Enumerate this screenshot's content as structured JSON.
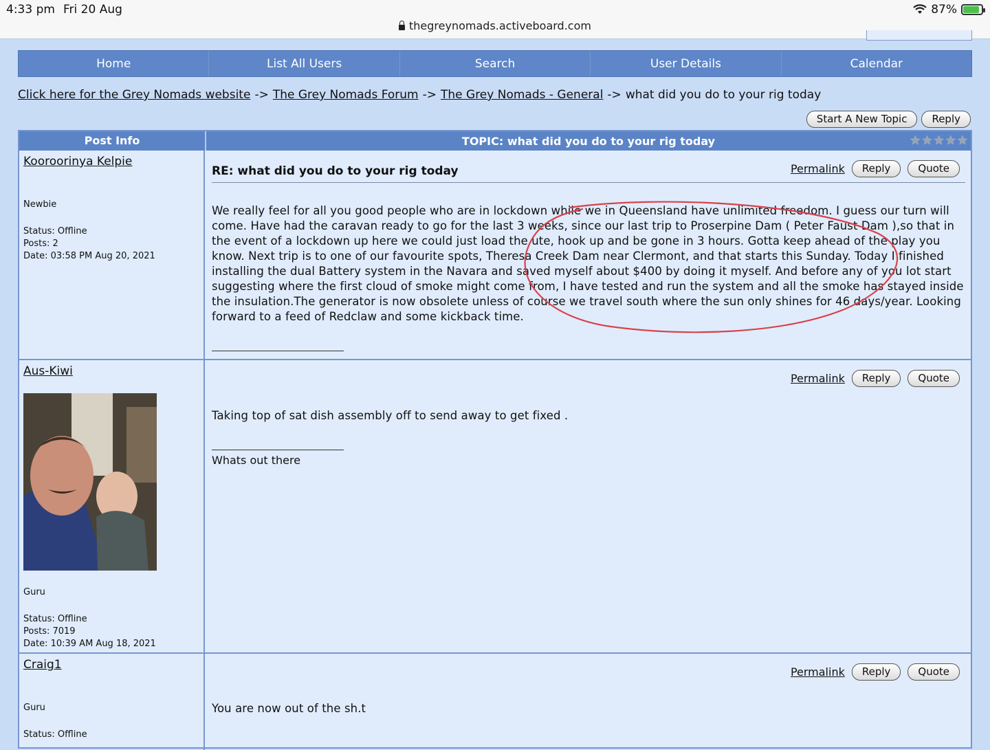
{
  "status_bar": {
    "time": "4:33 pm",
    "date": "Fri 20 Aug",
    "battery": "87%",
    "battery_level": 0.87
  },
  "browser": {
    "url": "thegreynomads.activeboard.com"
  },
  "nav": [
    "Home",
    "List All Users",
    "Search",
    "User Details",
    "Calendar"
  ],
  "breadcrumb": {
    "items": [
      "Click here for the Grey Nomads website",
      "The Grey Nomads Forum",
      "The Grey Nomads - General"
    ],
    "separator": "->",
    "current": "what did you do to your rig today"
  },
  "top_buttons": {
    "new_topic": "Start A New Topic",
    "reply": "Reply"
  },
  "table_header": {
    "left": "Post Info",
    "right": "TOPIC: what did you do to your rig today",
    "rating_stars": 5
  },
  "actions": {
    "permalink": "Permalink",
    "reply": "Reply",
    "quote": "Quote"
  },
  "posts": [
    {
      "username": "Kooroorinya Kelpie",
      "rank": "Newbie",
      "status": "Status: Offline",
      "posts": "Posts: 2",
      "date": "Date: 03:58 PM Aug 20, 2021",
      "title": "RE: what did you do to your rig today",
      "body": "We really feel for all you good people who are in lockdown while we in Queensland have unlimited freedom. I guess our turn will come. Have had the caravan ready to go for the last 3 weeks, since our last trip to Proserpine Dam ( Peter Faust Dam ),so that in the event of a lockdown up here we could just load the ute, hook up and be gone in 3 hours. Gotta keep ahead of the play you know. Next trip is to one of our favourite spots, Theresa Creek Dam near Clermont, and that starts this Sunday. Today I finished installing the dual Battery system in the Navara and saved myself about $400 by doing it myself. And before any of you lot start suggesting where the first cloud of smoke might come from, I have tested and run the system and all the smoke has stayed inside the insulation.The generator is now obsolete unless of course we travel south where the sun only shines for 46 days/year. Looking forward to a feed of Redclaw and some kickback time.",
      "signature": ""
    },
    {
      "username": "Aus-Kiwi",
      "rank": "Guru",
      "status": "Status: Offline",
      "posts": "Posts: 7019",
      "date": "Date: 10:39 AM Aug 18, 2021",
      "title": "",
      "body": "Taking top of sat dish assembly off to send away to get fixed .",
      "signature": "Whats out there"
    },
    {
      "username": "Craig1",
      "rank": "Guru",
      "status": "Status: Offline",
      "posts": "",
      "date": "",
      "title": "",
      "body": "You are now out of the sh.t",
      "signature": ""
    }
  ],
  "colors": {
    "nav_bg": "#5e86c8",
    "page_bg": "#c9dcf6",
    "cell_bg": "#e0ecfc",
    "annotation": "#d9414a"
  }
}
